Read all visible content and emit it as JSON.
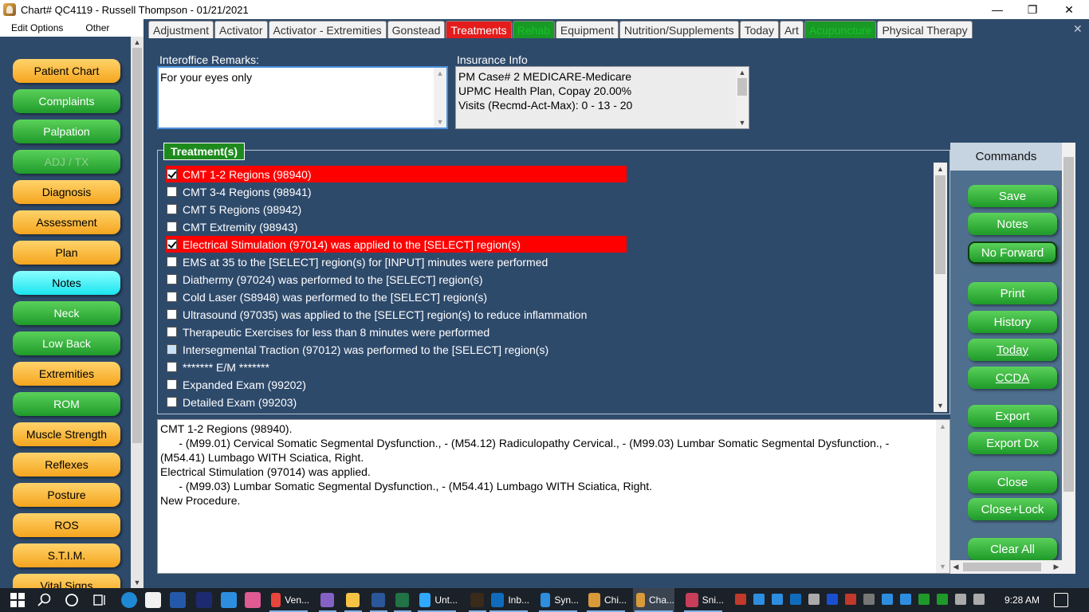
{
  "window": {
    "title": "Chart# QC4119 - Russell Thompson - 01/21/2021",
    "controls": {
      "minimize": "—",
      "maximize": "❐",
      "close": "✕"
    }
  },
  "menu": [
    "Edit Options",
    "Other"
  ],
  "sidebar": {
    "items": [
      {
        "label": "Patient Chart",
        "color": "orange"
      },
      {
        "label": "Complaints",
        "color": "green"
      },
      {
        "label": "Palpation",
        "color": "green"
      },
      {
        "label": "ADJ / TX",
        "color": "dim"
      },
      {
        "label": "Diagnosis",
        "color": "orange"
      },
      {
        "label": "Assessment",
        "color": "orange"
      },
      {
        "label": "Plan",
        "color": "orange"
      },
      {
        "label": "Notes",
        "color": "cyan"
      },
      {
        "label": "Neck",
        "color": "green"
      },
      {
        "label": "Low Back",
        "color": "green"
      },
      {
        "label": "Extremities",
        "color": "orange"
      },
      {
        "label": "ROM",
        "color": "green"
      },
      {
        "label": "Muscle Strength",
        "color": "orange"
      },
      {
        "label": "Reflexes",
        "color": "orange"
      },
      {
        "label": "Posture",
        "color": "orange"
      },
      {
        "label": "ROS",
        "color": "orange"
      },
      {
        "label": "S.T.I.M.",
        "color": "orange"
      },
      {
        "label": "Vital Signs",
        "color": "orange"
      }
    ]
  },
  "tabs": [
    {
      "label": "Adjustment",
      "style": "normal"
    },
    {
      "label": "Activator",
      "style": "normal"
    },
    {
      "label": "Activator - Extremities",
      "style": "normal"
    },
    {
      "label": "Gonstead",
      "style": "normal"
    },
    {
      "label": "Treatments",
      "style": "red"
    },
    {
      "label": "Rehab",
      "style": "green"
    },
    {
      "label": "Equipment",
      "style": "normal"
    },
    {
      "label": "Nutrition/Supplements",
      "style": "normal"
    },
    {
      "label": "Today",
      "style": "normal"
    },
    {
      "label": "Art",
      "style": "normal"
    },
    {
      "label": "Acupuncture",
      "style": "green"
    },
    {
      "label": "Physical Therapy",
      "style": "normal"
    }
  ],
  "tab_close": "✕",
  "remarks": {
    "label": "Interoffice Remarks:",
    "value": "For your eyes only"
  },
  "insurance": {
    "label": "Insurance Info",
    "lines": [
      "PM Case# 2  MEDICARE-Medicare",
      "UPMC Health Plan, Copay 20.00%",
      "Visits (Recmd-Act-Max):  0 - 13 - 20"
    ]
  },
  "treatments": {
    "title": "Treatment(s)",
    "items": [
      {
        "label": "CMT 1-2 Regions (98940)",
        "checked": true,
        "selected": true
      },
      {
        "label": "CMT 3-4 Regions (98941)",
        "checked": false,
        "selected": false
      },
      {
        "label": "CMT 5 Regions (98942)",
        "checked": false,
        "selected": false
      },
      {
        "label": "CMT Extremity (98943)",
        "checked": false,
        "selected": false
      },
      {
        "label": "Electrical Stimulation (97014) was applied to the [SELECT] region(s)",
        "checked": true,
        "selected": true
      },
      {
        "label": "EMS at 35  to the  [SELECT] region(s) for [INPUT] minutes were performed",
        "checked": false,
        "selected": false
      },
      {
        "label": "Diathermy (97024) was performed to the [SELECT] region(s)",
        "checked": false,
        "selected": false
      },
      {
        "label": "Cold Laser (S8948) was performed to the [SELECT] region(s)",
        "checked": false,
        "selected": false
      },
      {
        "label": "Ultrasound (97035) was applied to the [SELECT] region(s) to reduce inflammation",
        "checked": false,
        "selected": false
      },
      {
        "label": "Therapeutic Exercises for less than 8 minutes were performed",
        "checked": false,
        "selected": false
      },
      {
        "label": "Intersegmental Traction (97012) was performed to the [SELECT] region(s)",
        "checked": false,
        "selected": false,
        "focused": true
      },
      {
        "label": "******* E/M *******",
        "checked": false,
        "selected": false
      },
      {
        "label": "Expanded Exam (99202)",
        "checked": false,
        "selected": false
      },
      {
        "label": "Detailed Exam (99203)",
        "checked": false,
        "selected": false
      }
    ]
  },
  "notes": {
    "lines": [
      "CMT 1-2 Regions (98940).",
      "      - (M99.01) Cervical Somatic Segmental Dysfunction., - (M54.12) Radiculopathy Cervical., - (M99.03) Lumbar Somatic Segmental Dysfunction., -",
      "(M54.41) Lumbago WITH Sciatica, Right.",
      "Electrical Stimulation (97014) was applied.",
      "      - (M99.03) Lumbar Somatic Segmental Dysfunction., - (M54.41) Lumbago WITH Sciatica, Right.",
      "New Procedure."
    ]
  },
  "commands": {
    "title": "Commands",
    "buttons": [
      {
        "label": "Save",
        "underline": false,
        "outlined": false
      },
      {
        "label": "Notes",
        "underline": false,
        "outlined": false
      },
      {
        "label": "No Forward",
        "underline": false,
        "outlined": true
      },
      {
        "label": "Print",
        "underline": false,
        "outlined": false
      },
      {
        "label": "History",
        "underline": false,
        "outlined": false
      },
      {
        "label": "Today",
        "underline": true,
        "outlined": false
      },
      {
        "label": "CCDA",
        "underline": true,
        "outlined": false
      },
      {
        "label": "Export",
        "underline": false,
        "outlined": false
      },
      {
        "label": "Export Dx",
        "underline": false,
        "outlined": false
      },
      {
        "label": "Close",
        "underline": false,
        "outlined": false
      },
      {
        "label": "Close+Lock",
        "underline": false,
        "outlined": false
      },
      {
        "label": "Clear All",
        "underline": false,
        "outlined": false
      }
    ]
  },
  "taskbar": {
    "apps": [
      {
        "label": "Ven...",
        "icon": "chrome-icon",
        "color": "#e8453c"
      },
      {
        "label": "",
        "icon": "visual-studio-icon",
        "color": "#8661c5"
      },
      {
        "label": "",
        "icon": "folder-icon",
        "color": "#f6c344"
      },
      {
        "label": "",
        "icon": "word-icon",
        "color": "#2b579a"
      },
      {
        "label": "",
        "icon": "excel-icon",
        "color": "#217346"
      },
      {
        "label": "Unt...",
        "icon": "photoshop-icon",
        "color": "#31a8ff"
      },
      {
        "label": "",
        "icon": "bridge-icon",
        "color": "#3a2a1a"
      },
      {
        "label": "Inb...",
        "icon": "outlook-icon",
        "color": "#0f6cbd"
      },
      {
        "label": "Syn...",
        "icon": "sync-icon",
        "color": "#2d8ee0"
      },
      {
        "label": "Chi...",
        "icon": "chiro-icon",
        "color": "#d99a3a"
      },
      {
        "label": "Cha...",
        "icon": "chart-app-icon",
        "color": "#d99a3a"
      },
      {
        "label": "Sni...",
        "icon": "snipping-icon",
        "color": "#c83d5a"
      }
    ],
    "clock": "9:28 AM"
  }
}
